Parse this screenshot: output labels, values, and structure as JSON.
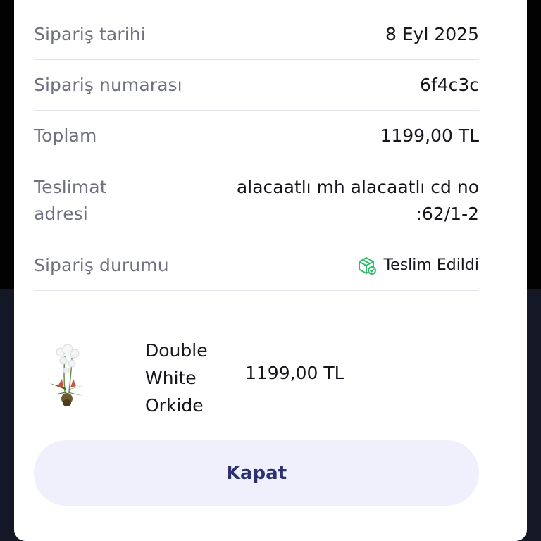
{
  "order": {
    "date_label": "Sipariş tarihi",
    "date_value": "8 Eyl 2025",
    "number_label": "Sipariş numarası",
    "number_value": "6f4c3c",
    "total_label": "Toplam",
    "total_value": "1199,00 TL",
    "address_label": "Teslimat adresi",
    "address_value": "alacaatlı mh alacaatlı cd no :62/1-2",
    "status_label": "Sipariş durumu",
    "status_value": "Teslim Edildi",
    "status_icon": "package-check-icon",
    "status_color": "#2fbf6a"
  },
  "product": {
    "name": "Double White Orkide",
    "price": "1199,00 TL"
  },
  "actions": {
    "close_label": "Kapat"
  },
  "colors": {
    "button_bg": "#eff0fb",
    "button_text": "#2e3170"
  }
}
